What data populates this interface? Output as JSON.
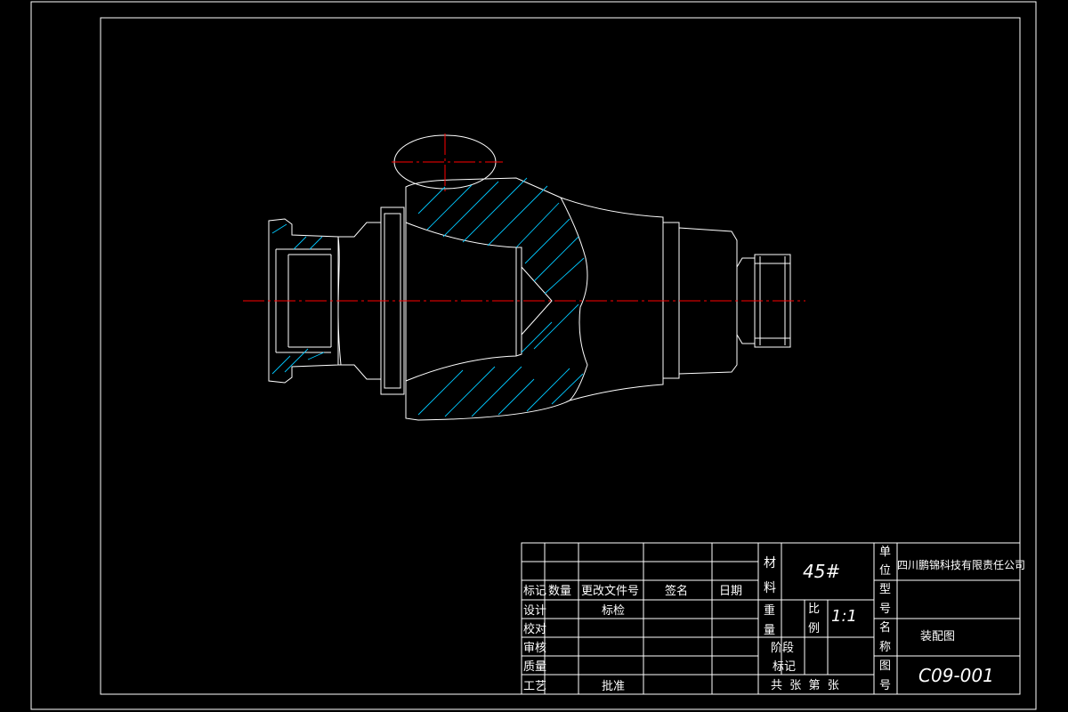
{
  "title_block": {
    "material_label_1": "材",
    "material_label_2": "料",
    "material_value": "45#",
    "weight_label_1": "重",
    "weight_label_2": "量",
    "scale_label_1": "比",
    "scale_label_2": "例",
    "scale_value": "1:1",
    "stage_label": "阶段",
    "mark_label": "标记",
    "sheets_text": "共  张  第  张",
    "unit_label": [
      "单",
      "位"
    ],
    "company": "四川鹏锦科技有限责任公司",
    "model_label": [
      "型",
      "号"
    ],
    "name_label": [
      "名",
      "称"
    ],
    "drawing_name": "装配图",
    "drawing_no_label": [
      "图",
      "号"
    ],
    "drawing_no": "C09-001"
  },
  "revision_table": {
    "headers": [
      "标记",
      "数量",
      "更改文件号",
      "签名",
      "日期"
    ],
    "rows": [
      "设计",
      "校对",
      "审核",
      "质量",
      "工艺"
    ],
    "std_check": "标检",
    "approve": "批准"
  },
  "colors": {
    "background": "#000000",
    "lines": "#ffffff",
    "centerline": "#ff0000",
    "hatch": "#00c8ff"
  }
}
